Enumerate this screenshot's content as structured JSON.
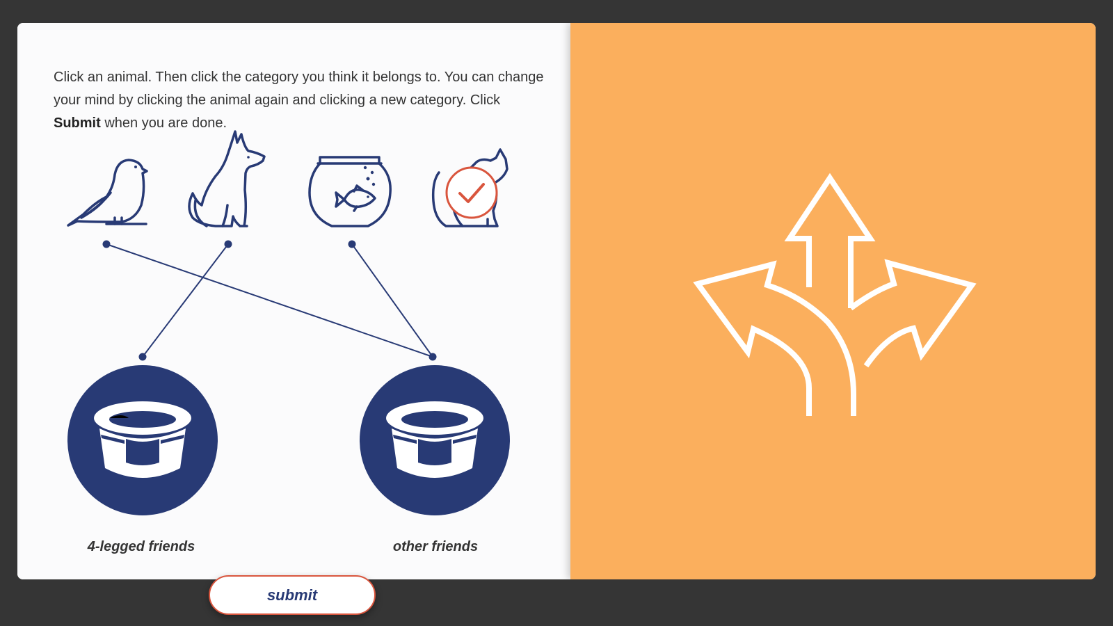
{
  "instructions": {
    "part1": "Click an animal. Then click the category you think it belongs to. You can change your mind by clicking the animal again and clicking a new category. Click ",
    "bold": "Submit",
    "part2": " when you are done."
  },
  "animals": [
    "bird-icon",
    "dog-icon",
    "fishbowl-icon",
    "cat-icon"
  ],
  "categories": {
    "left_label": "4-legged friends",
    "right_label": "other friends"
  },
  "submit_label": "submit",
  "colors": {
    "navy": "#283a75",
    "accent": "#d9553d",
    "panel_orange": "#fbaf5d",
    "background": "#353535"
  },
  "selected_animal": "cat-icon",
  "decor_icon": "split-arrows-icon"
}
